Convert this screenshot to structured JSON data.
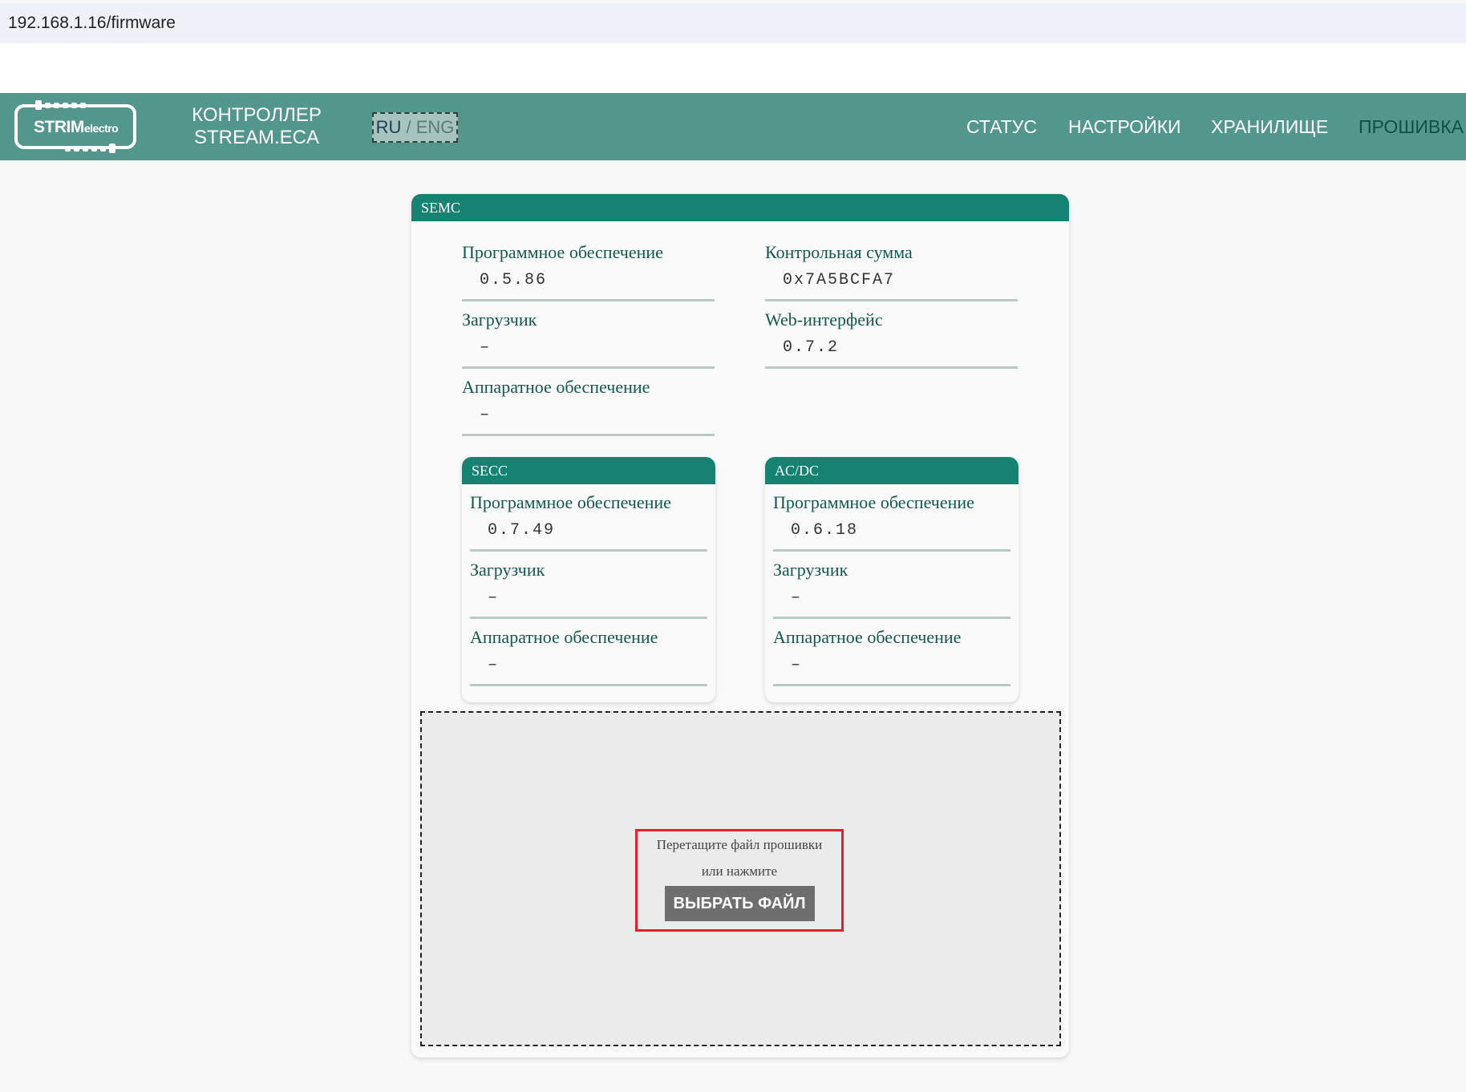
{
  "browser": {
    "url": "192.168.1.16/firmware"
  },
  "header": {
    "logo": {
      "main": "STRIM",
      "sub": "electro"
    },
    "brand_line1": "КОНТРОЛЛЕР",
    "brand_line2": "STREAM.ECA",
    "lang": {
      "ru": "RU",
      "separator": " / ",
      "eng": "ENG",
      "active": "RU"
    },
    "nav": [
      {
        "label": "СТАТУС"
      },
      {
        "label": "НАСТРОЙКИ"
      },
      {
        "label": "ХРАНИЛИЩЕ"
      },
      {
        "label": "ПРОШИВКА",
        "active": true
      }
    ]
  },
  "semc": {
    "title": "SEMC",
    "fields": [
      {
        "label": "Программное обеспечение",
        "value": "0.5.86"
      },
      {
        "label": "Контрольная сумма",
        "value": "0x7A5BCFA7"
      },
      {
        "label": "Загрузчик",
        "value": "–"
      },
      {
        "label": "Web-интерфейс",
        "value": "0.7.2"
      },
      {
        "label": "Аппаратное обеспечение",
        "value": "–"
      }
    ]
  },
  "secc": {
    "title": "SECC",
    "fields": [
      {
        "label": "Программное обеспечение",
        "value": "0.7.49"
      },
      {
        "label": "Загрузчик",
        "value": "–"
      },
      {
        "label": "Аппаратное обеспечение",
        "value": "–"
      }
    ]
  },
  "acdc": {
    "title": "AC/DC",
    "fields": [
      {
        "label": "Программное обеспечение",
        "value": "0.6.18"
      },
      {
        "label": "Загрузчик",
        "value": "–"
      },
      {
        "label": "Аппаратное обеспечение",
        "value": "–"
      }
    ]
  },
  "upload": {
    "line1": "Перетащите файл прошивки",
    "line2": "или нажмите",
    "button": "ВЫБРАТЬ ФАЙЛ"
  },
  "colors": {
    "navbar": "#53978c",
    "card_header": "#158272",
    "label_text": "#11584e",
    "highlight_border": "#e0202a",
    "button": "#6e6e6e"
  }
}
